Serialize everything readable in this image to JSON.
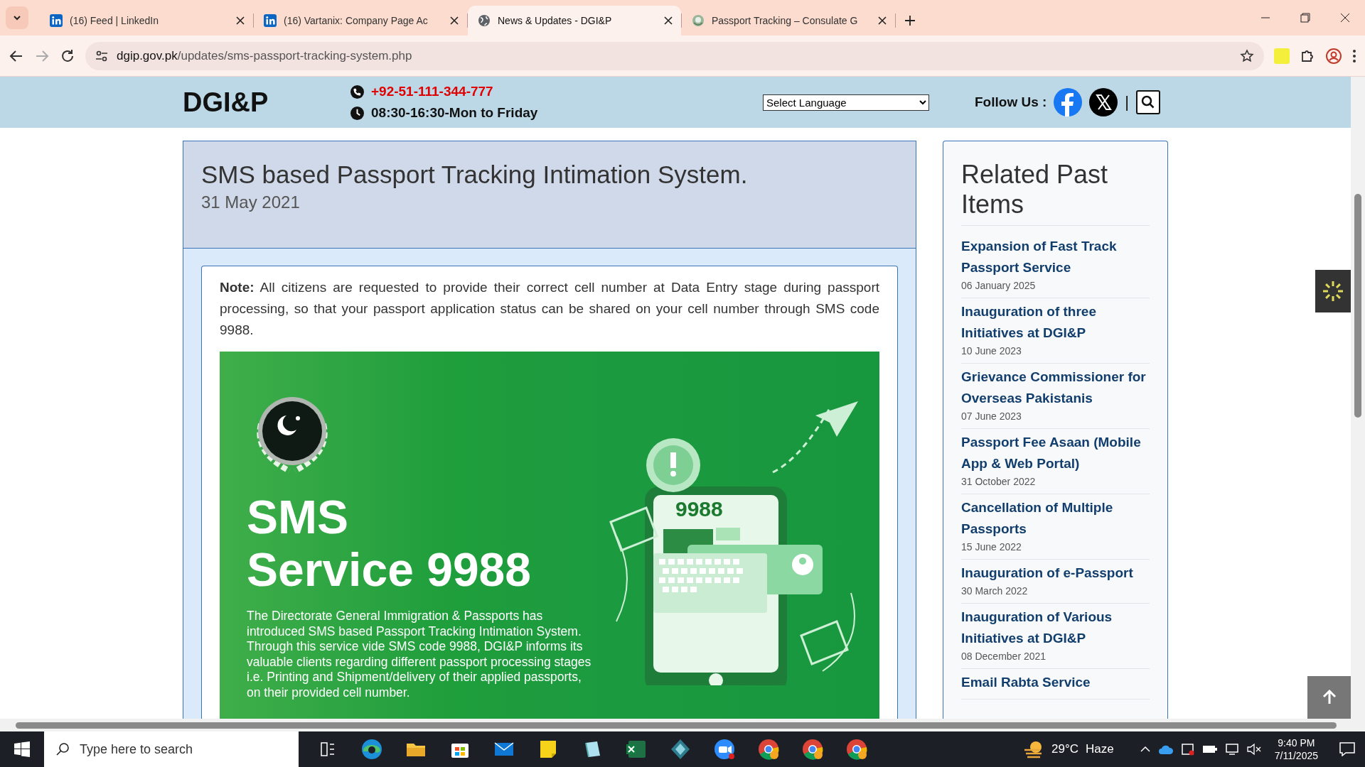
{
  "browser": {
    "tabs": [
      {
        "title": "(16) Feed | LinkedIn",
        "selected": false
      },
      {
        "title": "(16) Vartanix: Company Page Ac",
        "selected": false
      },
      {
        "title": "News & Updates - DGI&P",
        "selected": true
      },
      {
        "title": "Passport Tracking – Consulate G",
        "selected": false
      }
    ],
    "url_host": "dgip.gov.pk",
    "url_path": "/updates/sms-passport-tracking-system.php"
  },
  "site_header": {
    "logo": "DGI&P",
    "phone": "+92-51-111-344-777",
    "hours": "08:30-16:30-Mon to Friday",
    "language_select": "Select Language",
    "follow_label": "Follow Us :",
    "separator": "|"
  },
  "article": {
    "title": "SMS based Passport Tracking Intimation System.",
    "date": "31 May 2021",
    "note": "**Note:** All citizens are requested to provide their correct cell number at Data Entry stage during passport processing, so that your passport application status can be shared on your cell number through SMS code 9988.",
    "banner": {
      "headline": [
        "SMS",
        "Service 9988"
      ],
      "body": [
        "The Directorate General Immigration & Passports has introduced SMS based Passport Tracking Intimation System.",
        "Through this service vide SMS code 9988, DGI&P informs its valuable clients regarding different passport processing stages i.e. Printing and Shipment/delivery of their applied passports, on their provided cell number."
      ],
      "phone_screen_text": "9988"
    }
  },
  "related": {
    "heading": "Related Past Items",
    "items": [
      {
        "title": "Expansion of Fast Track Passport Service",
        "date": "06 January 2025"
      },
      {
        "title": "Inauguration of three Initiatives at DGI&P",
        "date": "10 June 2023"
      },
      {
        "title": "Grievance Commissioner for Overseas Pakistanis",
        "date": "07 June 2023"
      },
      {
        "title": "Passport Fee Asaan (Mobile App & Web Portal)",
        "date": "31 October 2022"
      },
      {
        "title": "Cancellation of Multiple Passports",
        "date": "15 June 2022"
      },
      {
        "title": "Inauguration of e-Passport",
        "date": "30 March 2022"
      },
      {
        "title": "Inauguration of Various Initiatives at DGI&P",
        "date": "08 December 2021"
      },
      {
        "title": "Email Rabta Service"
      }
    ]
  },
  "taskbar": {
    "search_placeholder": "Type here to search",
    "temperature": "29°C",
    "weather": "Haze",
    "time": "9:40 PM",
    "date": "7/11/2025"
  }
}
